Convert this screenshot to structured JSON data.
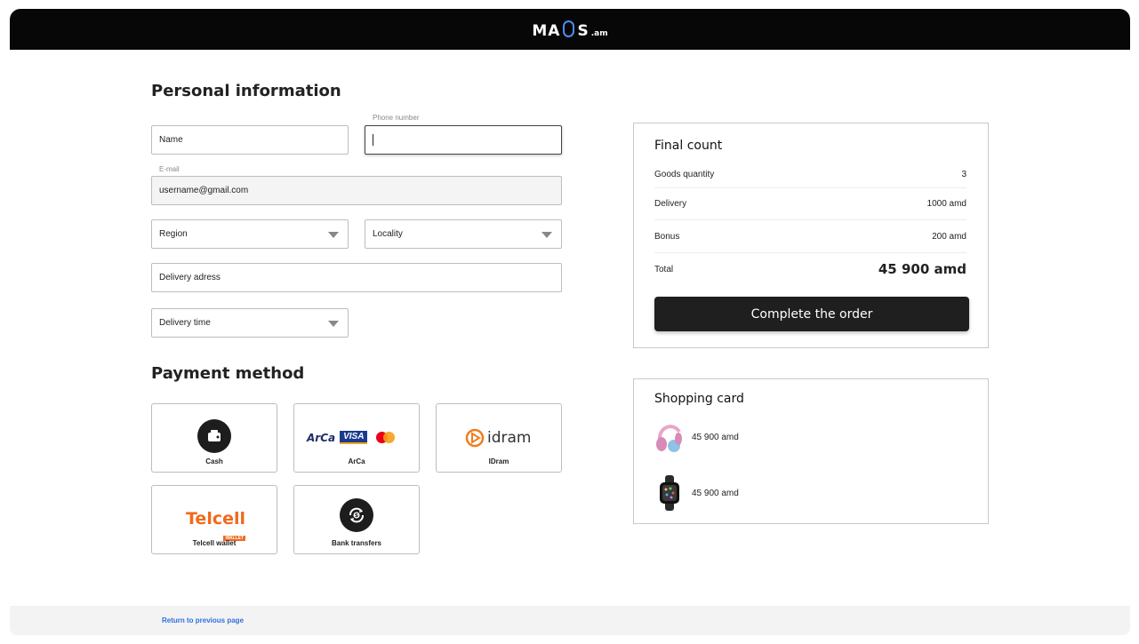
{
  "header": {
    "logo": {
      "left": "MA",
      "right": "S",
      "tld": ".am"
    }
  },
  "personal": {
    "title": "Personal information",
    "name_placeholder": "Name",
    "phone_label": "Phone number",
    "email_label": "E-mail",
    "email_value": "username@gmail.com",
    "region": "Region",
    "locality": "Locality",
    "address_placeholder": "Delivery adress",
    "delivery_time": "Delivery time"
  },
  "payment": {
    "title": "Payment method",
    "methods": [
      {
        "label": "Cash",
        "icon": "wallet-icon"
      },
      {
        "label": "ArCa",
        "icon": "arca-visa-mastercard-logos",
        "logos": [
          "ArCa",
          "VISA"
        ]
      },
      {
        "label": "IDram",
        "icon": "idram-logo",
        "logo_text": "idram"
      },
      {
        "label": "Telcell wallet",
        "icon": "telcell-logo",
        "logo_text": "Telcell",
        "logo_sub": "WALLET"
      },
      {
        "label": "Bank transfers",
        "icon": "bank-transfer-icon"
      }
    ]
  },
  "summary": {
    "title": "Final count",
    "rows": [
      {
        "label": "Goods quantity",
        "value": "3"
      },
      {
        "label": "Delivery",
        "value": "1000 amd"
      },
      {
        "label": "Bonus",
        "value": "200 amd"
      }
    ],
    "total_label": "Total",
    "total_value": "45 900 amd",
    "cta": "Complete the order"
  },
  "cart": {
    "title": "Shopping card",
    "items": [
      {
        "price": "45 900 amd",
        "icon": "headphones-thumbnail"
      },
      {
        "price": "45 900 amd",
        "icon": "smartwatch-thumbnail"
      }
    ]
  },
  "footer": {
    "back_link": "Return to previous page"
  },
  "colors": {
    "accent": "#2f6fe0",
    "header_bg": "#070707",
    "button_bg": "#1f1f1f",
    "telcell": "#f06a1c",
    "idram": "#f07d1f"
  }
}
